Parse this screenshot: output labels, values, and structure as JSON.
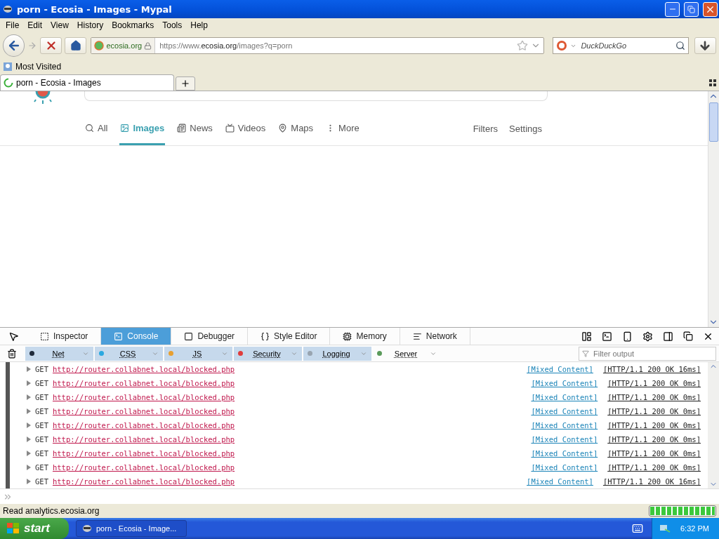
{
  "window": {
    "title": "porn - Ecosia - Images - Mypal"
  },
  "menu": [
    "File",
    "Edit",
    "View",
    "History",
    "Bookmarks",
    "Tools",
    "Help"
  ],
  "navbar": {
    "site_identity": "ecosia.org",
    "url": {
      "prefix": "https://www.",
      "domain": "ecosia.org",
      "path": "/images?q=porn"
    },
    "search_placeholder": "DuckDuckGo"
  },
  "bookmarks": [
    "Most Visited"
  ],
  "tabs": [
    {
      "label": "porn - Ecosia - Images",
      "selected": true,
      "loading": true
    }
  ],
  "page": {
    "nav": [
      {
        "label": "All",
        "kind": "search",
        "selected": false
      },
      {
        "label": "Images",
        "kind": "image",
        "selected": true
      },
      {
        "label": "News",
        "kind": "news",
        "selected": false
      },
      {
        "label": "Videos",
        "kind": "video",
        "selected": false
      },
      {
        "label": "Maps",
        "kind": "map",
        "selected": false
      },
      {
        "label": "More",
        "kind": "more",
        "selected": false
      }
    ],
    "links": [
      "Filters",
      "Settings"
    ]
  },
  "devtools": {
    "tabs": [
      {
        "label": "Inspector",
        "kind": "inspector",
        "selected": false
      },
      {
        "label": "Console",
        "kind": "console",
        "selected": true
      },
      {
        "label": "Debugger",
        "kind": "debugger",
        "selected": false
      },
      {
        "label": "Style Editor",
        "kind": "style",
        "selected": false
      },
      {
        "label": "Memory",
        "kind": "memory",
        "selected": false
      },
      {
        "label": "Network",
        "kind": "network",
        "selected": false
      }
    ],
    "filters": [
      {
        "label": "Net",
        "color": "#1e2a3a",
        "on": true
      },
      {
        "label": "CSS",
        "color": "#2aa8e0",
        "on": true
      },
      {
        "label": "JS",
        "color": "#e8a030",
        "on": true
      },
      {
        "label": "Security",
        "color": "#e03c3c",
        "on": true
      },
      {
        "label": "Logging",
        "color": "#98a4b0",
        "on": true
      },
      {
        "label": "Server",
        "color": "#5a9a5a",
        "on": false
      }
    ],
    "filter_placeholder": "Filter output",
    "rows": [
      {
        "method": "GET",
        "url": "http://router.collabnet.local/blocked.php",
        "tag": "[Mixed Content]",
        "status": "[HTTP/1.1 200 OK 16ms]"
      },
      {
        "method": "GET",
        "url": "http://router.collabnet.local/blocked.php",
        "tag": "[Mixed Content]",
        "status": "[HTTP/1.1 200 OK 0ms]"
      },
      {
        "method": "GET",
        "url": "http://router.collabnet.local/blocked.php",
        "tag": "[Mixed Content]",
        "status": "[HTTP/1.1 200 OK 0ms]"
      },
      {
        "method": "GET",
        "url": "http://router.collabnet.local/blocked.php",
        "tag": "[Mixed Content]",
        "status": "[HTTP/1.1 200 OK 0ms]"
      },
      {
        "method": "GET",
        "url": "http://router.collabnet.local/blocked.php",
        "tag": "[Mixed Content]",
        "status": "[HTTP/1.1 200 OK 0ms]"
      },
      {
        "method": "GET",
        "url": "http://router.collabnet.local/blocked.php",
        "tag": "[Mixed Content]",
        "status": "[HTTP/1.1 200 OK 0ms]"
      },
      {
        "method": "GET",
        "url": "http://router.collabnet.local/blocked.php",
        "tag": "[Mixed Content]",
        "status": "[HTTP/1.1 200 OK 0ms]"
      },
      {
        "method": "GET",
        "url": "http://router.collabnet.local/blocked.php",
        "tag": "[Mixed Content]",
        "status": "[HTTP/1.1 200 OK 0ms]"
      },
      {
        "method": "GET",
        "url": "http://router.collabnet.local/blocked.php",
        "tag": "[Mixed Content]",
        "status": "[HTTP/1.1 200 OK 16ms]"
      }
    ]
  },
  "status_bar": {
    "text": "Read analytics.ecosia.org",
    "level": 1
  },
  "taskbar": {
    "start": "start",
    "task": "porn - Ecosia - Image...",
    "clock": "6:32 PM"
  }
}
